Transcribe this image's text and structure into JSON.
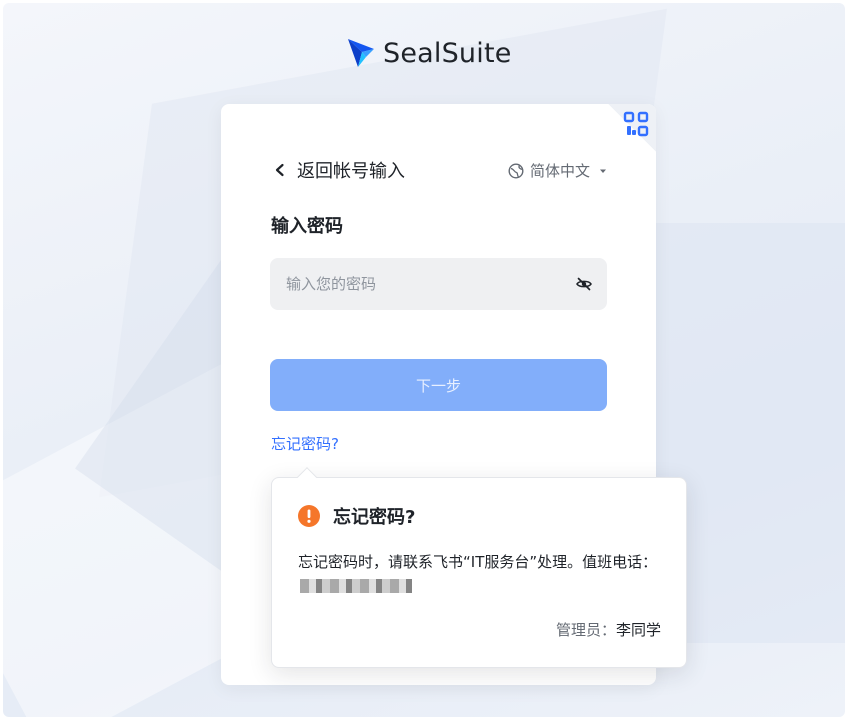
{
  "brand": {
    "name": "SealSuite"
  },
  "login": {
    "back_label": "返回帐号输入",
    "language": "简体中文",
    "form_title": "输入密码",
    "password": {
      "placeholder": "输入您的密码",
      "value": ""
    },
    "next_button": "下一步",
    "forgot_link": "忘记密码?"
  },
  "popover": {
    "title": "忘记密码?",
    "body_text": "忘记密码时，请联系飞书“IT服务台”处理。值班电话：",
    "admin_label": "管理员：",
    "admin_name": "李同学"
  },
  "icons": {
    "back": "chevron-left-icon",
    "language": "globe-icon",
    "caret": "caret-down-icon",
    "qr": "qr-code-icon",
    "eye": "eye-off-icon",
    "warning": "warning-icon"
  },
  "colors": {
    "primary": "#3370ff",
    "button_disabled": "#82aefa",
    "warning": "#f5762a",
    "input_bg": "#eff0f2"
  }
}
